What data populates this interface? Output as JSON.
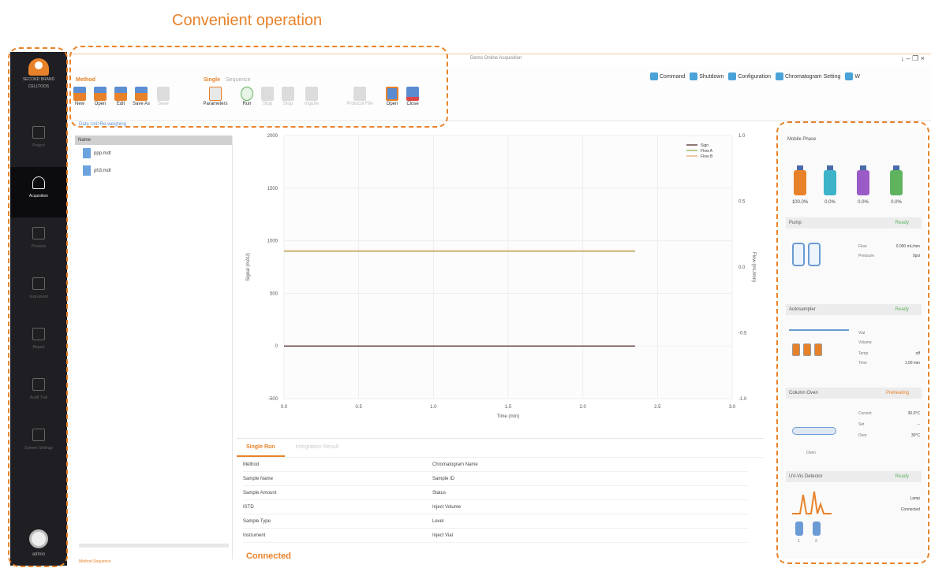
{
  "caption": "Convenient operation",
  "sidebar": {
    "logo_line1": "SECOND BRAND",
    "logo_line2": "CELLTOOS",
    "items": [
      {
        "label": "Project"
      },
      {
        "label": "Acquisition"
      },
      {
        "label": "Process"
      },
      {
        "label": "Instrument"
      },
      {
        "label": "Report"
      },
      {
        "label": "Audit Trail"
      },
      {
        "label": "System Settings"
      }
    ],
    "user": "admin"
  },
  "window": {
    "title": "Demo Online Acquisition",
    "controls": "↓ – ❐ ×"
  },
  "ribbon": {
    "method_group": "Method",
    "single_tab": "Single",
    "sequence_tab": "Sequence",
    "buttons": [
      "New",
      "Open",
      "Edit",
      "Save As",
      "Save",
      "Parameters",
      "Run",
      "Stop",
      "Stop",
      "Inquire",
      "Protocol File",
      "Open",
      "Close"
    ]
  },
  "quick_links": [
    "Command",
    "Shutdown",
    "Configuration",
    "Chromatogram Setting",
    "W"
  ],
  "breadcrumb": "Data Unit   Re-weighing",
  "tree": {
    "header": "Name",
    "items": [
      "ppp.mdt",
      "ph3.mdt"
    ]
  },
  "bottom_left_tabs": "Method   Sequence",
  "chart_data": {
    "type": "line",
    "xlabel": "Time (min)",
    "ylabel": "Signal (mAU)",
    "y2label": "Flow (mL/min)",
    "xlim": [
      0,
      3
    ],
    "ylim": [
      -500,
      2000
    ],
    "y2lim": [
      -1.0,
      1.0
    ],
    "x_ticks": [
      "0.0",
      "0.5",
      "1.0",
      "1.5",
      "2.0",
      "2.5",
      "3.0"
    ],
    "y_ticks": [
      "-500",
      "0",
      "500",
      "1000",
      "1500",
      "2000"
    ],
    "y2_ticks": [
      "-1.0",
      "-0.5",
      "0.0",
      "0.5",
      "1.0"
    ],
    "legend": [
      "Sign",
      "Flow A",
      "Flow B"
    ],
    "legend_position": "top-right",
    "series": [
      {
        "name": "Sign",
        "color": "#6b4a4a",
        "x": [
          0,
          2.35
        ],
        "y": [
          0,
          0
        ]
      },
      {
        "name": "Flow A",
        "color": "#a3b86e",
        "x": [
          0,
          2.35
        ],
        "y": [
          900,
          900
        ]
      },
      {
        "name": "Flow B",
        "color": "#e8b88a",
        "x": [
          0,
          2.35
        ],
        "y": [
          905,
          905
        ]
      }
    ]
  },
  "bottom_panel": {
    "tabs": [
      "Single Run",
      "Integration Result"
    ],
    "rows": [
      [
        "Method",
        "Chromatogram Name"
      ],
      [
        "Sample Name",
        "Sample ID"
      ],
      [
        "Sample Amount",
        "Status"
      ],
      [
        "ISTD",
        "Inject Volume"
      ],
      [
        "Sample Type",
        "Level"
      ],
      [
        "Instrument",
        "Inject Vial"
      ]
    ],
    "status": "Connected"
  },
  "right_panel": {
    "mobile_phase": {
      "title": "Mobile Phase",
      "percents": [
        "100.0%",
        "0.0%",
        "0.0%",
        "0.0%"
      ],
      "colors": [
        "#e8822a",
        "#3cb3c9",
        "#9a5bc6",
        "#5fb35f"
      ]
    },
    "pump": {
      "title": "Pump",
      "status": "Ready",
      "rows": [
        [
          "Flow",
          "0.000 mL/min"
        ],
        [
          "Pressure",
          "0psi"
        ]
      ]
    },
    "autosampler": {
      "title": "Autosampler",
      "status": "Ready",
      "rows": [
        [
          "Vial",
          ""
        ],
        [
          "Volume",
          ""
        ],
        [
          "Temp",
          "off"
        ],
        [
          "Time",
          "1.00 min"
        ]
      ]
    },
    "column_oven": {
      "title": "Column Oven",
      "status": "Preheating",
      "rows": [
        [
          "Current",
          "30.0°C"
        ],
        [
          "Set",
          "--"
        ],
        [
          "Door",
          "30°C"
        ]
      ],
      "label": "Oven"
    },
    "detector": {
      "title": "UV-Vis Detector",
      "status": "Ready",
      "rows": [
        "Lamp",
        "Connected"
      ],
      "lamps": [
        "1",
        "2"
      ]
    }
  }
}
